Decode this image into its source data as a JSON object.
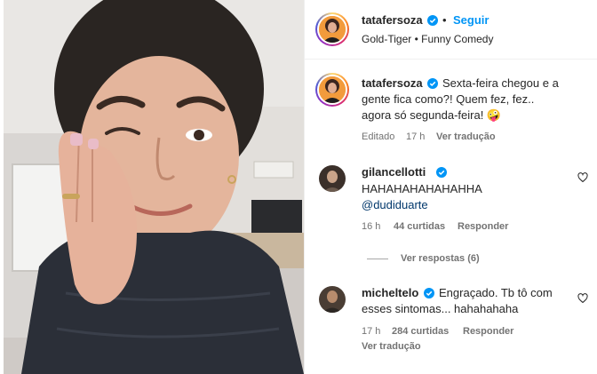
{
  "post": {
    "author": {
      "username": "tatafersoza",
      "follow_label": "Seguir",
      "separator": "•",
      "audio": "Gold-Tiger • Funny Comedy"
    },
    "caption": {
      "username": "tatafersoza",
      "line1": "Sexta-feira chegou e a",
      "line2": "gente fica como?! Quem fez, fez..",
      "line3": "agora só segunda-feira! 🤪",
      "edited": "Editado",
      "time": "17 h",
      "translate": "Ver tradução"
    }
  },
  "comments": [
    {
      "username": "gilancellotti",
      "line1": "HAHAHAHAHAHAHHA",
      "mention": "@dudiduarte",
      "time": "16 h",
      "likes": "44 curtidas",
      "reply": "Responder",
      "view_replies": "Ver respostas (6)"
    },
    {
      "username": "micheltelo",
      "line1": "Engraçado. Tb tô com",
      "line2": "esses sintomas... hahahahaha",
      "time": "17 h",
      "likes": "284 curtidas",
      "reply": "Responder",
      "translate": "Ver tradução"
    }
  ],
  "colors": {
    "link_blue": "#0095f6",
    "verified_blue": "#0095f6",
    "muted": "#737373",
    "jacket": "#2b2f38"
  },
  "icons": [
    "verified-badge-icon",
    "heart-icon"
  ]
}
